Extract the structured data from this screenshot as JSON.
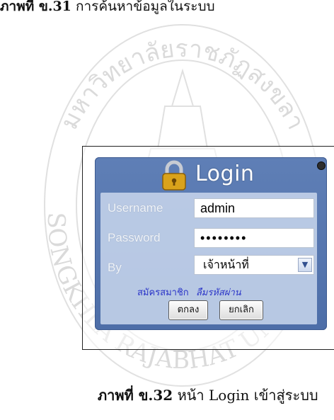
{
  "page": {
    "top_text_bold": "ภาพที่ ข.31",
    "top_text_rest": " การค้นหาข้อมูลในระบบ",
    "caption_bold": "ภาพที่ ข.32",
    "caption_rest": " หน้า Login เข้าสู่ระบบ"
  },
  "watermark": {
    "arc_top": "มหาวิทยาลัยราชภัฏสงขลา",
    "arc_bottom": "SONGKHLA RAJABHAT UNIVERSITY"
  },
  "login": {
    "title": "Login",
    "username_label": "Username",
    "username_value": "admin",
    "password_label": "Password",
    "password_value": "••••••••",
    "by_label": "By",
    "by_selected": "เจ้าหน้าที่",
    "register_link": "สมัครสมาชิก",
    "forgot_link": "ลืมรหัสผ่าน",
    "ok_button": "ตกลง",
    "cancel_button": "ยกเลิก"
  },
  "colors": {
    "panel_blue": "#5f7fb6",
    "link_blue": "#2b35c8",
    "lock_gold": "#d9a21b"
  },
  "icons": {
    "lock": "padlock-icon",
    "dropdown": "chevron-down-icon"
  }
}
